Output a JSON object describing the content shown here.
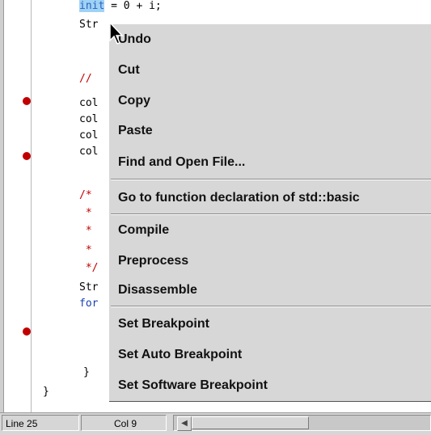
{
  "editor": {
    "code_lines": [
      {
        "prefix": "",
        "sel": "init",
        "rest": " = 0 + i;",
        "cls": ""
      },
      {
        "prefix": "Str",
        "sel": "",
        "rest": "",
        "cls": ""
      },
      {
        "prefix": "//",
        "sel": "",
        "rest": "",
        "cls": "cm"
      },
      {
        "prefix": "col",
        "sel": "",
        "rest": "",
        "cls": ""
      },
      {
        "prefix": "col",
        "sel": "",
        "rest": "",
        "cls": ""
      },
      {
        "prefix": "col",
        "sel": "",
        "rest": "",
        "cls": ""
      },
      {
        "prefix": "col",
        "sel": "",
        "rest": "",
        "cls": ""
      },
      {
        "prefix": "/*",
        "sel": "",
        "rest": "",
        "cls": "cm"
      },
      {
        "prefix": " *",
        "sel": "",
        "rest": "",
        "cls": "cm"
      },
      {
        "prefix": " *",
        "sel": "",
        "rest": "",
        "cls": "cm"
      },
      {
        "prefix": " *",
        "sel": "",
        "rest": "",
        "cls": "cm"
      },
      {
        "prefix": " */",
        "sel": "",
        "rest": "",
        "cls": "cm"
      },
      {
        "prefix": "Str",
        "sel": "",
        "rest": "",
        "cls": ""
      },
      {
        "prefix": "for",
        "sel": "",
        "rest": "",
        "cls": "kw"
      },
      {
        "prefix": "}",
        "sel": "",
        "rest": "",
        "cls": ""
      },
      {
        "prefix": "}",
        "sel": "",
        "rest": "",
        "cls": ""
      }
    ]
  },
  "context_menu": {
    "items": [
      {
        "label": "Undo"
      },
      {
        "label": "Cut"
      },
      {
        "label": "Copy"
      },
      {
        "label": "Paste"
      },
      {
        "label": "Find and Open File..."
      },
      {
        "label": "Go to function declaration of std::basic"
      },
      {
        "label": "Compile"
      },
      {
        "label": "Preprocess"
      },
      {
        "label": "Disassemble"
      },
      {
        "label": "Set Breakpoint"
      },
      {
        "label": "Set Auto Breakpoint"
      },
      {
        "label": "Set Software Breakpoint"
      }
    ]
  },
  "statusbar": {
    "line": "Line 25",
    "col": "Col 9"
  },
  "colors": {
    "breakpoint": "#c00000",
    "selection": "#9fd3f5",
    "menu_bg": "#d7d7d7"
  },
  "icons": {
    "breakpoint": "red-dot",
    "cursor": "arrow-pointer",
    "scroll_left": "left-arrow"
  }
}
